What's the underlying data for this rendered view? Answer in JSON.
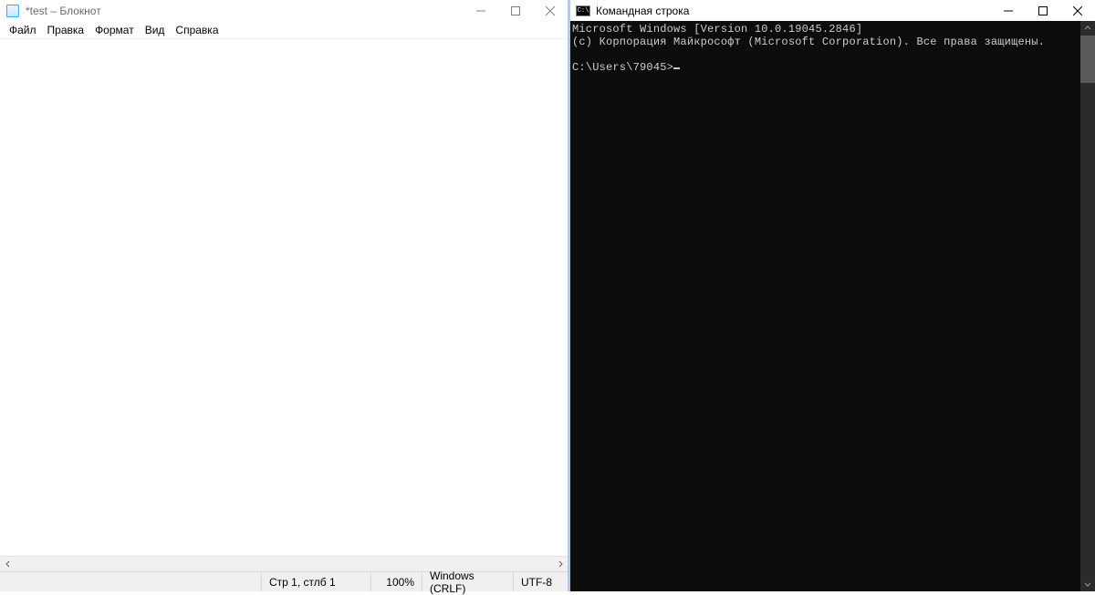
{
  "notepad": {
    "title": "*test – Блокнот",
    "menus": {
      "file": "Файл",
      "edit": "Правка",
      "format": "Формат",
      "view": "Вид",
      "help": "Справка"
    },
    "content": "",
    "status": {
      "pos": "Стр 1, стлб 1",
      "zoom": "100%",
      "line_ending": "Windows (CRLF)",
      "encoding": "UTF-8"
    }
  },
  "cmd": {
    "title": "Командная строка",
    "icon_glyph": "C:\\",
    "lines": {
      "l1": "Microsoft Windows [Version 10.0.19045.2846]",
      "l2": "(c) Корпорация Майкрософт (Microsoft Corporation). Все права защищены.",
      "l3": "",
      "l4": "C:\\Users\\79045>"
    }
  }
}
